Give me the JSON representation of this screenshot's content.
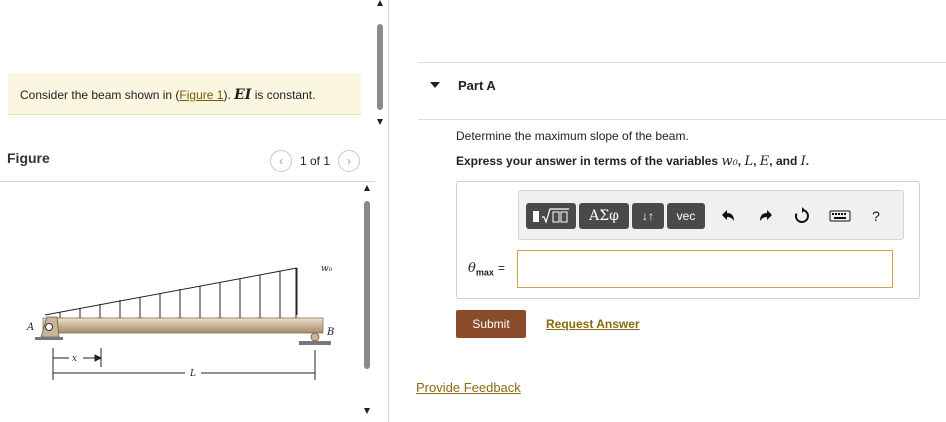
{
  "intro": {
    "prefix": "Consider the beam shown in (",
    "link": "Figure 1",
    "suffix": ").",
    "ei": "EI",
    "rest": "is constant."
  },
  "figure": {
    "title": "Figure",
    "pager_count": "1 of 1",
    "prev_icon": "chevron-left-icon",
    "next_icon": "chevron-right-icon",
    "labels": {
      "a": "A",
      "b": "B",
      "w0": "w₀",
      "x": "x",
      "l": "L"
    }
  },
  "part": {
    "title": "Part A",
    "question": "Determine the maximum slope of the beam.",
    "instruction_prefix": "Express your answer in terms of the variables",
    "vars": {
      "w0": "w₀",
      "l": "L",
      "e": "E",
      "i": "I"
    },
    "and": "and",
    "period": "."
  },
  "toolbar": {
    "templates_icon": "fraction-sqrt-icon",
    "greek_label": "ΑΣφ",
    "updown_label": "↓↑",
    "vec_label": "vec",
    "undo_icon": "undo-icon",
    "redo_icon": "redo-icon",
    "reset_icon": "reset-icon",
    "keyboard_icon": "keyboard-icon",
    "help_label": "?"
  },
  "answer": {
    "label_symbol": "θ",
    "label_sub": "max",
    "equals": "=",
    "value": ""
  },
  "buttons": {
    "submit": "Submit",
    "request_answer": "Request Answer",
    "feedback": "Provide Feedback"
  },
  "colors": {
    "intro_bg": "#fbf6e0",
    "submit_bg": "#8a4b2b",
    "link": "#8a6a10",
    "toolbar_dark": "#4a4a4a"
  }
}
